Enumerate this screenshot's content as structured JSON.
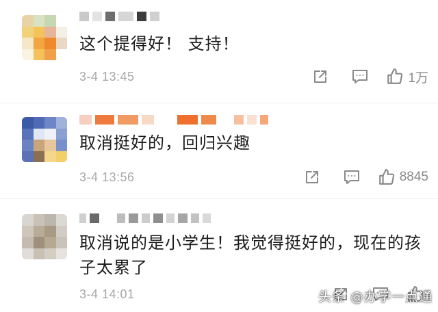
{
  "colors": {
    "text": "#1b1b1b",
    "meta": "#a8a8a8",
    "icon": "#8a8a8a"
  },
  "comments": [
    {
      "text": "这个提得好！ 支持！",
      "time": "3-4 13:45",
      "likes": "1万"
    },
    {
      "text": "取消挺好的，回归兴趣",
      "time": "3-4 13:56",
      "likes": "8845"
    },
    {
      "text": "取消说的是小学生！我觉得挺好的，现在的孩子太累了",
      "time": "3-4 14:01",
      "likes": ""
    }
  ],
  "icons": {
    "share": "share-icon",
    "reply": "comment-icon",
    "like": "thumbs-up-icon"
  },
  "watermark": "头条 @办学一点通"
}
